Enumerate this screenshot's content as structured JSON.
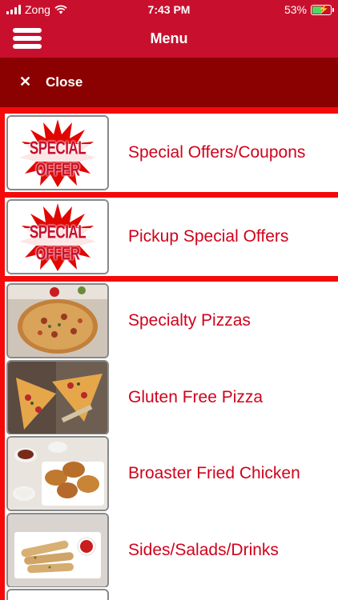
{
  "status_bar": {
    "carrier": "Zong",
    "time": "7:43 PM",
    "battery": "53%",
    "battery_level": 0.53
  },
  "header": {
    "title": "Menu",
    "menu_icon": "hamburger-icon"
  },
  "close_bar": {
    "icon": "close-icon",
    "label": "Close"
  },
  "menu_items": [
    {
      "label": "Special Offers/Coupons",
      "thumbnail": "special-offer-badge",
      "badge_text": "SPECIAL OFFER"
    },
    {
      "label": "Pickup Special Offers",
      "thumbnail": "special-offer-badge",
      "badge_text": "SPECIAL OFFER"
    },
    {
      "label": "Specialty Pizzas",
      "thumbnail": "pizza-photo"
    },
    {
      "label": "Gluten Free Pizza",
      "thumbnail": "pizza-slices-photo"
    },
    {
      "label": "Broaster Fried Chicken",
      "thumbnail": "fried-chicken-photo"
    },
    {
      "label": "Sides/Salads/Drinks",
      "thumbnail": "breadsticks-photo"
    }
  ],
  "colors": {
    "header_red": "#c8102e",
    "close_bar_red": "#8b0000",
    "list_background_red": "#f40a0a",
    "label_red": "#d0021b"
  }
}
